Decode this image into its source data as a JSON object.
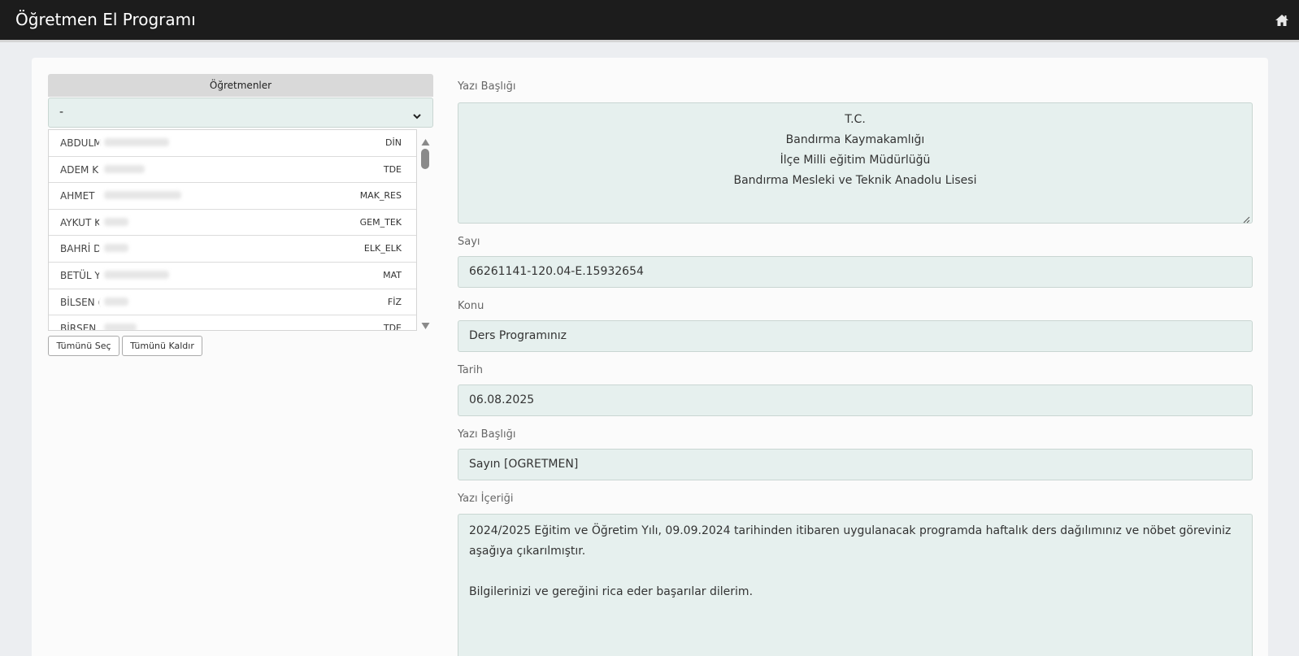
{
  "app": {
    "title": "Öğretmen El Programı"
  },
  "teachers": {
    "header": "Öğretmenler",
    "selected": "-",
    "items": [
      {
        "name": "ABDULM",
        "branch": "DİN"
      },
      {
        "name": "ADEM K",
        "branch": "TDE"
      },
      {
        "name": "AHMET",
        "branch": "MAK_RES"
      },
      {
        "name": "AYKUT K",
        "branch": "GEM_TEK"
      },
      {
        "name": "BAHRİ D",
        "branch": "ELK_ELK"
      },
      {
        "name": "BETÜL Y",
        "branch": "MAT"
      },
      {
        "name": "BİLSEN (",
        "branch": "FİZ"
      },
      {
        "name": "BİRSEN",
        "branch": "TDE"
      }
    ],
    "select_all": "Tümünü Seç",
    "remove_all": "Tümünü Kaldır"
  },
  "form": {
    "header_label": "Yazı Başlığı",
    "header_lines": [
      "T.C.",
      "Bandırma Kaymakamlığı",
      "İlçe Milli eğitim Müdürlüğü",
      "Bandırma Mesleki ve Teknik Anadolu Lisesi"
    ],
    "number_label": "Sayı",
    "number_value": "66261141-120.04-E.15932654",
    "subject_label": "Konu",
    "subject_value": "Ders Programınız",
    "date_label": "Tarih",
    "date_value": "06.08.2025",
    "salutation_label": "Yazı Başlığı",
    "salutation_value": "Sayın [OGRETMEN]",
    "content_label": "Yazı İçeriği",
    "content_line1": "2024/2025 Eğitim ve Öğretim Yılı, 09.09.2024 tarihinden itibaren uygulanacak programda haftalık ders dağılımınız ve nöbet göreviniz",
    "content_line2": "aşağıya çıkarılmıştır.",
    "content_line3": "Bilgilerinizi ve gereğini rica eder başarılar dilerim."
  }
}
